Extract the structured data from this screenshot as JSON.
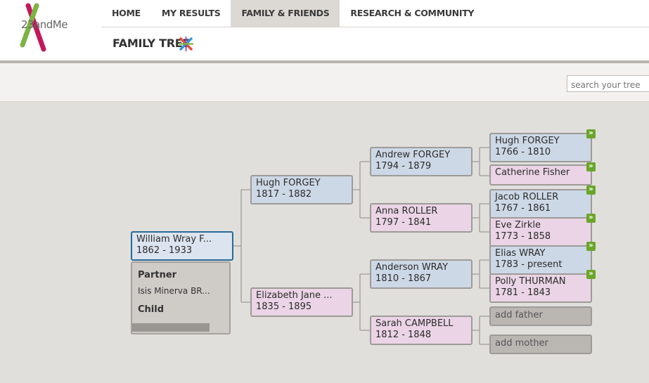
{
  "app": {
    "logo_text": "23andMe"
  },
  "nav": {
    "items": [
      {
        "label": "HOME"
      },
      {
        "label": "MY RESULTS"
      },
      {
        "label": "FAMILY & FRIENDS",
        "active": true
      },
      {
        "label": "RESEARCH & COMMUNITY"
      }
    ]
  },
  "page": {
    "title": "FAMILY TREE"
  },
  "search": {
    "placeholder": "search your tree"
  },
  "tree": {
    "root": {
      "name": "William Wray F...",
      "years": "1862 - 1933"
    },
    "panel": {
      "partner_label": "Partner",
      "partner_value": "Isis Minerva BR...",
      "child_label": "Child"
    },
    "father": {
      "name": "Hugh FORGEY",
      "years": "1817 - 1882"
    },
    "mother": {
      "name": "Elizabeth Jane ...",
      "years": "1835 - 1895"
    },
    "pgf": {
      "name": "Andrew FORGEY",
      "years": "1794 - 1879"
    },
    "pgm": {
      "name": "Anna ROLLER",
      "years": "1797 - 1841"
    },
    "mgf": {
      "name": "Anderson WRAY",
      "years": "1810 - 1867"
    },
    "mgm": {
      "name": "Sarah CAMPBELL",
      "years": "1812 - 1848"
    },
    "g1": {
      "name": "Hugh FORGEY",
      "years": "1766 - 1810"
    },
    "g2": {
      "name": "Catherine Fisher",
      "years": ""
    },
    "g3": {
      "name": "Jacob ROLLER",
      "years": "1767 - 1861"
    },
    "g4": {
      "name": "Eve Zirkle",
      "years": "1773 - 1858"
    },
    "g5": {
      "name": "Elias WRAY",
      "years": "1783 - present"
    },
    "g6": {
      "name": "Polly THURMAN",
      "years": "1781 - 1843"
    },
    "add_father": "add father",
    "add_mother": "add mother",
    "expand_glyph": "»"
  },
  "colors": {
    "male": "#cdd8e6",
    "female": "#ead4e5",
    "focus_border": "#2a6b96",
    "expand": "#6aa629"
  }
}
